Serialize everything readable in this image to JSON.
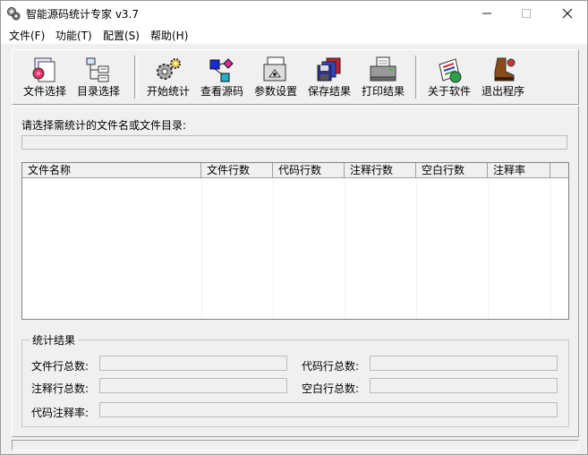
{
  "window": {
    "title": "智能源码统计专家 v3.7"
  },
  "menu": [
    "文件(F)",
    "功能(T)",
    "配置(S)",
    "帮助(H)"
  ],
  "toolbar": {
    "file_select": "文件选择",
    "dir_select": "目录选择",
    "start_stats": "开始统计",
    "view_source": "查看源码",
    "param_settings": "参数设置",
    "save_results": "保存结果",
    "print_results": "打印结果",
    "about": "关于软件",
    "exit": "退出程序"
  },
  "prompt": "请选择需统计的文件名或文件目录:",
  "path_value": "",
  "table": {
    "columns": [
      "文件名称",
      "文件行数",
      "代码行数",
      "注释行数",
      "空白行数",
      "注释率"
    ],
    "rows": []
  },
  "results": {
    "title": "统计结果",
    "file_lines_label": "文件行总数:",
    "code_lines_label": "代码行总数:",
    "comment_lines_label": "注释行总数:",
    "blank_lines_label": "空白行总数:",
    "comment_ratio_label": "代码注释率:",
    "file_lines_value": "",
    "code_lines_value": "",
    "comment_lines_value": "",
    "blank_lines_value": "",
    "comment_ratio_value": ""
  }
}
